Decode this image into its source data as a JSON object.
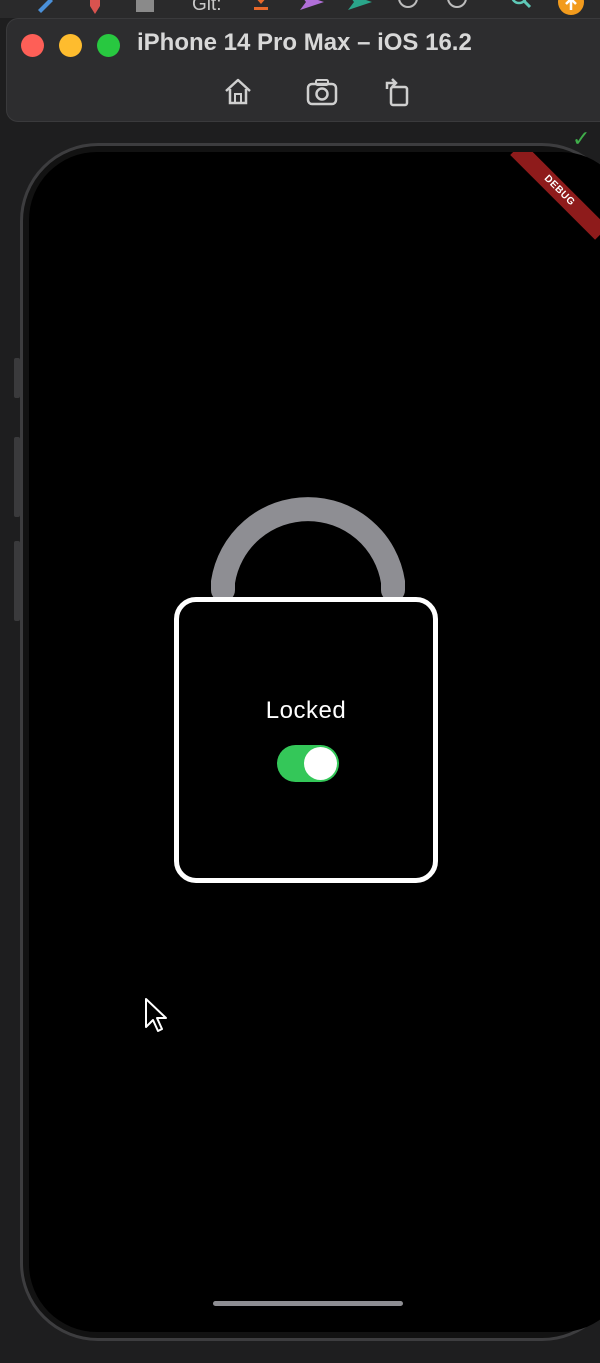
{
  "toolbar": {
    "git_label": "Git:",
    "icons": [
      "edit-icon",
      "pin-icon",
      "stop-icon",
      "git-update-icon",
      "git-commit-icon",
      "git-push-icon",
      "history-icon",
      "rollback-icon",
      "search-icon",
      "update-badge-icon"
    ]
  },
  "window": {
    "title": "iPhone 14 Pro Max – iOS 16.2",
    "buttons": [
      "home-icon",
      "screenshot-icon",
      "rotate-icon"
    ]
  },
  "app": {
    "debug_banner": "DEBUG",
    "lock_status": "Locked",
    "toggle_on": true
  },
  "colors": {
    "toggle_on": "#34c759",
    "shackle": "#8e8e93",
    "debug_banner": "#8e1b1b",
    "lock_border": "#ffffff"
  }
}
